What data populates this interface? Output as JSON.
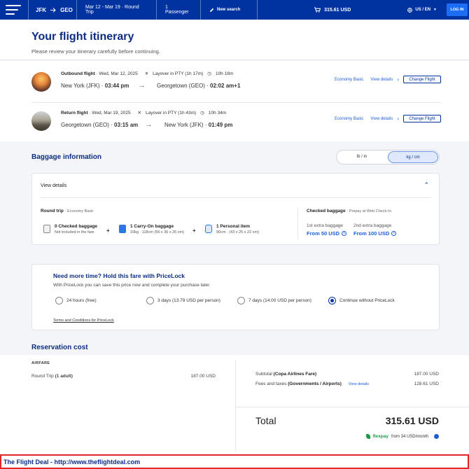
{
  "nav": {
    "origin": "JFK",
    "destination": "GEO",
    "dates": "Mar 12 - Mar 19 · Round Trip",
    "passengers": "1 Passenger",
    "new_search": "New search",
    "price": "315.61 USD",
    "language": "US / EN",
    "login": "LOG IN"
  },
  "header": {
    "title": "Your flight itinerary",
    "subtitle": "Please review your itinerary carefully before continuing."
  },
  "flights": [
    {
      "label": "Outbound flight",
      "date": "· Wed, Mar 12, 2025",
      "layover": "Layover in PTY (1h 17m)",
      "duration": "10h 18m",
      "origin": "New York (JFK) · ",
      "depart_time": "03:44 pm",
      "dest": "Georgetown (GEO) · ",
      "arrive_time": "02:02 am+1",
      "fare": "Economy Basic",
      "view_details": "View details",
      "change": "Change Flight"
    },
    {
      "label": "Return flight",
      "date": "· Wed, Mar 19, 2025",
      "layover": "Layover in PTY (1h 43m)",
      "duration": "10h 34m",
      "origin": "Georgetown (GEO) · ",
      "depart_time": "03:15 am",
      "dest": "New York (JFK) · ",
      "arrive_time": "01:49 pm",
      "fare": "Economy Basic",
      "view_details": "View details",
      "change": "Change Flight"
    }
  ],
  "baggage": {
    "title": "Baggage information",
    "units": [
      "lb / in",
      "kg / cm"
    ],
    "active_unit": "kg / cm",
    "view_details": "View details",
    "round_trip": "Round trip",
    "fare": "· Economy Basic",
    "items": [
      {
        "title": "0 Checked baggage",
        "detail": "Not included in the fare"
      },
      {
        "title": "1 Carry-On baggage",
        "detail": "10kg · 118cm (56 x 36 x 26 cm)"
      },
      {
        "title": "1 Personal item",
        "detail": "90cm · (43 x 25 x 22 cm)"
      }
    ],
    "checked_title": "Checked baggage",
    "checked_note": "· Prepay at Web Check-In.",
    "extra": [
      {
        "label": "1st extra baggage",
        "value": "From 50 USD"
      },
      {
        "label": "2nd extra baggage",
        "value": "From 100 USD"
      }
    ]
  },
  "pricelock": {
    "title": "Need more time? Hold this fare with PriceLock",
    "subtitle": "With PriceLock you can save this price now and complete your purchase later.",
    "options": [
      "24 hours (free)",
      "3 days (13.79 USD per person)",
      "7 days (14.00 USD per person)",
      "Continue without PriceLock"
    ],
    "selected_index": 3,
    "terms": "Terms and Conditions for PriceLock"
  },
  "reservation": {
    "title": "Reservation cost",
    "airfare_label": "AIRFARE",
    "round_trip_label": "Round Trip",
    "round_trip_pax": "(1 adult)",
    "round_trip_amount": "187.00 USD",
    "subtotal_label": "Subtotal",
    "subtotal_note": "(Copa Airlines Fare)",
    "subtotal_amount": "187.00 USD",
    "fees_label": "Fees and taxes",
    "fees_note": "(Governments / Airports)",
    "fees_link": "View details",
    "fees_amount": "128.61 USD",
    "total_label": "Total",
    "total_amount": "315.61 USD",
    "flexpay_brand": "flexpay",
    "flexpay_text": "from 34 USD/month"
  },
  "banner": {
    "text": "The Flight Deal - http://www.theflightdeal.com"
  },
  "colors": {
    "brand_blue": "#0032a0",
    "link_blue": "#1d5fd6",
    "title_navy": "#0c2d82",
    "flexpay_green": "#1a9a46",
    "banner_border": "#e0272a"
  }
}
